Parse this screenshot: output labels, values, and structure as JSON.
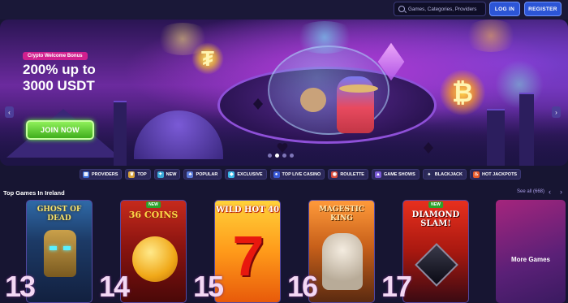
{
  "header": {
    "search_placeholder": "Games, Categories, Providers",
    "login_label": "LOG IN",
    "register_label": "REGISTER"
  },
  "hero": {
    "tag": "Crypto Welcome Bonus",
    "title_line1": "200% up to",
    "title_line2": "3000 USDT",
    "cta_label": "JOIN NOW",
    "slides_count": 4,
    "active_slide": 1
  },
  "categories": [
    {
      "label": "PROVIDERS",
      "icon": "providers-icon"
    },
    {
      "label": "TOP",
      "icon": "trophy-icon"
    },
    {
      "label": "NEW",
      "icon": "new-icon"
    },
    {
      "label": "POPULAR",
      "icon": "popular-icon"
    },
    {
      "label": "EXCLUSIVE",
      "icon": "diamond-icon"
    },
    {
      "label": "TOP LIVE CASINO",
      "icon": "live-casino-icon"
    },
    {
      "label": "ROULETTE",
      "icon": "roulette-icon"
    },
    {
      "label": "GAME SHOWS",
      "icon": "game-shows-icon"
    },
    {
      "label": "BLACKJACK",
      "icon": "blackjack-icon"
    },
    {
      "label": "HOT JACKPOTS",
      "icon": "fire-icon"
    }
  ],
  "top_games": {
    "title": "Top Games In Ireland",
    "see_all": "See all (668)",
    "items": [
      {
        "rank": "13",
        "name": "GHOST OF DEAD",
        "badge": ""
      },
      {
        "rank": "14",
        "name": "36 COINS",
        "badge": "NEW"
      },
      {
        "rank": "15",
        "name": "WILD HOT 40",
        "badge": ""
      },
      {
        "rank": "16",
        "name": "MAGESTIC KING",
        "badge": ""
      },
      {
        "rank": "17",
        "name": "DIAMOND SLAM!",
        "badge": "NEW"
      }
    ],
    "more_label": "More Games"
  }
}
